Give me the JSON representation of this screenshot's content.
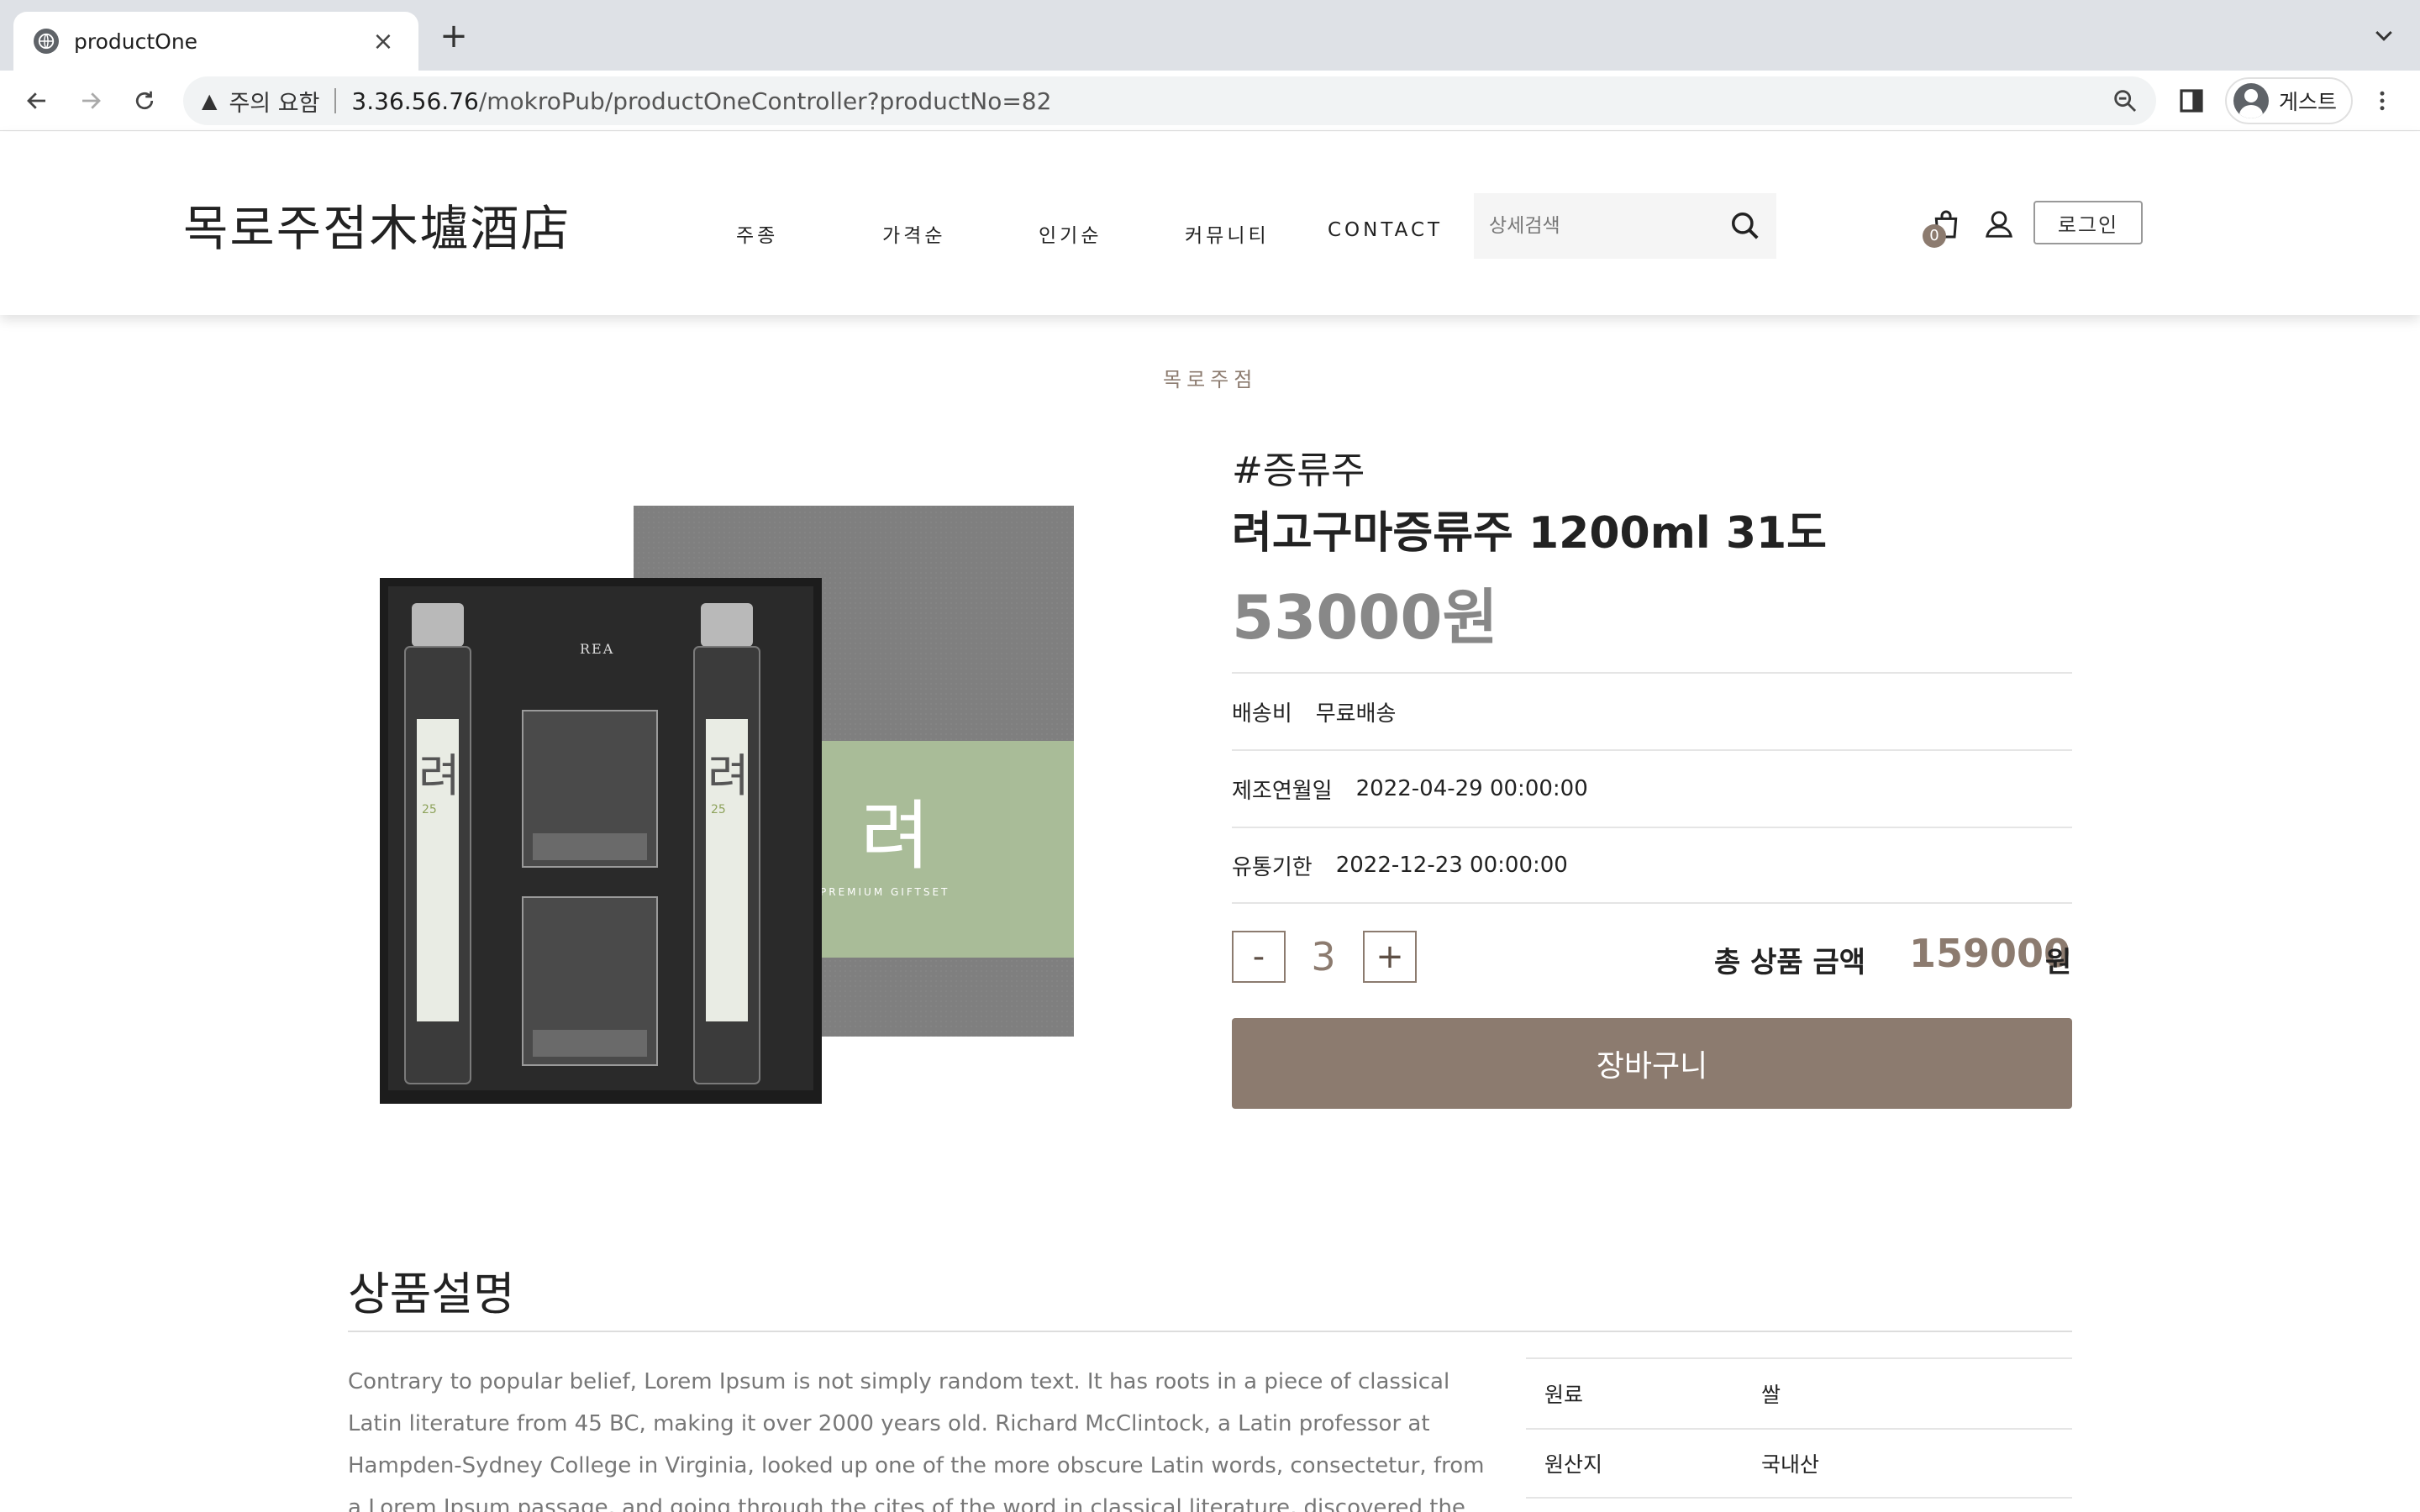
{
  "browser": {
    "tab_title": "productOne",
    "new_tab_label": "+",
    "close_label": "×",
    "security_label": "주의 요함",
    "url_host": "3.36.56.76",
    "url_path": "/mokroPub/productOneController?productNo=82",
    "profile_label": "게스트"
  },
  "header": {
    "logo": "목로주점木壚酒店",
    "nav": [
      "주종",
      "가격순",
      "인기순",
      "커뮤니티",
      "CONTACT"
    ],
    "search_placeholder": "상세검색",
    "cart_count": "0",
    "login_label": "로그인"
  },
  "product": {
    "brand": "목로주점",
    "category": "#증류주",
    "title": "려고구마증류주 1200ml 31도",
    "price": "53000원",
    "info": [
      {
        "key": "배송비",
        "value": "무료배송"
      },
      {
        "key": "제조연월일",
        "value": "2022-04-29 00:00:00"
      },
      {
        "key": "유통기한",
        "value": "2022-12-23 00:00:00"
      }
    ],
    "qty_minus": "-",
    "qty_plus": "+",
    "quantity": "3",
    "total_label": "총 상품 금액",
    "total_value": "159000",
    "total_unit": "원",
    "cart_button": "장바구니",
    "box_text": "PREMIUM GIFTSET",
    "inner_text": "REA",
    "bottle_char": "려",
    "bottle_num": "25"
  },
  "description": {
    "heading": "상품설명",
    "text": "Contrary to popular belief, Lorem Ipsum is not simply random text. It has roots in a piece of classical Latin literature from 45 BC, making it over 2000 years old. Richard McClintock, a Latin professor at Hampden-Sydney College in Virginia, looked up one of the more obscure Latin words, consectetur, from a Lorem Ipsum passage, and going through the cites of the word in classical literature, discovered the undoubtable source. Lorem Ipsum comes",
    "specs": [
      {
        "key": "원료",
        "value": "쌀"
      },
      {
        "key": "원산지",
        "value": "국내산"
      }
    ]
  },
  "colors": {
    "accent": "#8c7b6f",
    "price_gray": "#888888",
    "box_green": "#a9bc98",
    "box_gray": "#7d7d7d"
  }
}
